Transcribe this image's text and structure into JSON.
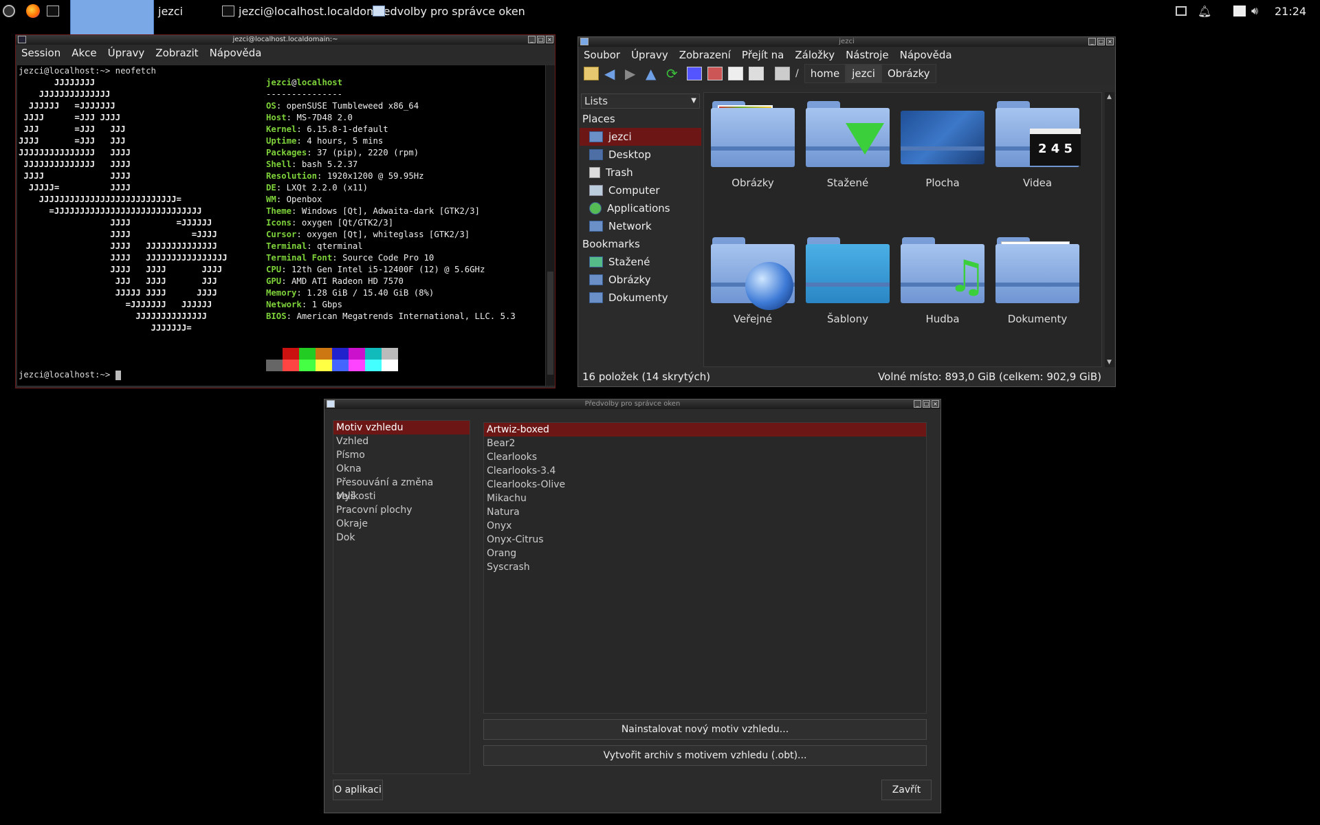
{
  "taskbar": {
    "launcher_label": "jezci",
    "task1": "jezci@localhost.localdom...",
    "task2": "Předvolby pro správce oken",
    "time": "21:24"
  },
  "terminal": {
    "title": "jezci@localhost.localdomain:~",
    "menu": [
      "Session",
      "Akce",
      "Úpravy",
      "Zobrazit",
      "Nápověda"
    ],
    "command_line": "jezci@localhost:~> neofetch",
    "logo_lines": [
      "       JJJJJJJJ",
      "    JJJJJJJJJJJJJJ",
      "  JJJJJJ   =JJJJJJJ",
      " JJJJ      =JJJ JJJJ",
      " JJJ       =JJJ   JJJ",
      "JJJJ       =JJJ   JJJ",
      "JJJJJJJJJJJJJJJ   JJJJ",
      " JJJJJJJJJJJJJJ   JJJJ",
      " JJJJ             JJJJ",
      "  JJJJJ=          JJJJ",
      "    JJJJJJJJJJJJJJJJJJJJJJJJJJJ=",
      "      =JJJJJJJJJJJJJJJJJJJJJJJJJJJJJ",
      "                  JJJJ         =JJJJJJ",
      "                  JJJJ            =JJJJ",
      "                  JJJJ   JJJJJJJJJJJJJJ",
      "                  JJJJ   JJJJJJJJJJJJJJJJ",
      "                  JJJJ   JJJJ       JJJJ",
      "                   JJJ   JJJJ       JJJ",
      "                   JJJJJ JJJJ      JJJJ",
      "                     =JJJJJJJ   JJJJJJ",
      "                       JJJJJJJJJJJJJJ",
      "                          JJJJJJJ="
    ],
    "user": "jezci",
    "at": "@",
    "hostname": "localhost",
    "separator": "---------------",
    "info": [
      {
        "k": "OS",
        "v": "openSUSE Tumbleweed x86_64"
      },
      {
        "k": "Host",
        "v": "MS-7D48 2.0"
      },
      {
        "k": "Kernel",
        "v": "6.15.8-1-default"
      },
      {
        "k": "Uptime",
        "v": "4 hours, 5 mins"
      },
      {
        "k": "Packages",
        "v": "37 (pip), 2220 (rpm)"
      },
      {
        "k": "Shell",
        "v": "bash 5.2.37"
      },
      {
        "k": "Resolution",
        "v": "1920x1200 @ 59.95Hz"
      },
      {
        "k": "DE",
        "v": "LXQt 2.2.0 (x11)"
      },
      {
        "k": "WM",
        "v": "Openbox"
      },
      {
        "k": "Theme",
        "v": "Windows [Qt], Adwaita-dark [GTK2/3]"
      },
      {
        "k": "Icons",
        "v": "oxygen [Qt/GTK2/3]"
      },
      {
        "k": "Cursor",
        "v": "oxygen [Qt], whiteglass [GTK2/3]"
      },
      {
        "k": "Terminal",
        "v": "qterminal"
      },
      {
        "k": "Terminal Font",
        "v": "Source Code Pro 10"
      },
      {
        "k": "CPU",
        "v": "12th Gen Intel i5-12400F (12) @ 5.6GHz"
      },
      {
        "k": "GPU",
        "v": "AMD ATI Radeon HD 7570"
      },
      {
        "k": "Memory",
        "v": "1.28 GiB / 15.40 GiB (8%)"
      },
      {
        "k": "Network",
        "v": "1 Gbps"
      },
      {
        "k": "BIOS",
        "v": "American Megatrends International, LLC. 5.3"
      }
    ],
    "swatches_top": [
      "#000000",
      "#cc1111",
      "#22cc22",
      "#cc7711",
      "#2222cc",
      "#cc11cc",
      "#11bbbb",
      "#bbbbbb"
    ],
    "swatches_bottom": [
      "#666666",
      "#ff4444",
      "#44ff44",
      "#ffff44",
      "#4466ff",
      "#ff44ff",
      "#44ffff",
      "#ffffff"
    ],
    "prompt": "jezci@localhost:~> ",
    "colors": {
      "key": "#7ed23a",
      "text": "#eeeeee",
      "selection": "#6d1616"
    }
  },
  "filemanager": {
    "title": "jezci",
    "menu": [
      "Soubor",
      "Úpravy",
      "Zobrazení",
      "Přejít na",
      "Záložky",
      "Nástroje",
      "Nápověda"
    ],
    "path_root": "/",
    "breadcrumbs": [
      "home",
      "jezci",
      "Obrázky"
    ],
    "view_select": "Lists",
    "places_header": "Places",
    "places": [
      "jezci",
      "Desktop",
      "Trash",
      "Computer",
      "Applications",
      "Network"
    ],
    "bookmarks_header": "Bookmarks",
    "bookmarks": [
      "Stažené",
      "Obrázky",
      "Dokumenty"
    ],
    "items": [
      "Obrázky",
      "Stažené",
      "Plocha",
      "Videa",
      "Veřejné",
      "Šablony",
      "Hudba",
      "Dokumenty"
    ],
    "clapper_digits": "2 4 5",
    "status_left": "16 položek (14 skrytých)",
    "status_right": "Volné místo: 893,0 GiB (celkem: 902,9 GiB)"
  },
  "prefs": {
    "title": "Předvolby pro správce oken",
    "categories": [
      "Motiv vzhledu",
      "Vzhled",
      "Písmo",
      "Okna",
      "Přesouvání a změna velikosti",
      "Myš",
      "Pracovní plochy",
      "Okraje",
      "Dok"
    ],
    "themes": [
      "Artwiz-boxed",
      "Bear2",
      "Clearlooks",
      "Clearlooks-3.4",
      "Clearlooks-Olive",
      "Mikachu",
      "Natura",
      "Onyx",
      "Onyx-Citrus",
      "Orang",
      "Syscrash"
    ],
    "install_button": "Nainstalovat nový motiv vzhledu...",
    "archive_button": "Vytvořit archiv s motivem vzhledu (.obt)...",
    "about_button": "O aplikaci",
    "close_button": "Zavřít"
  }
}
